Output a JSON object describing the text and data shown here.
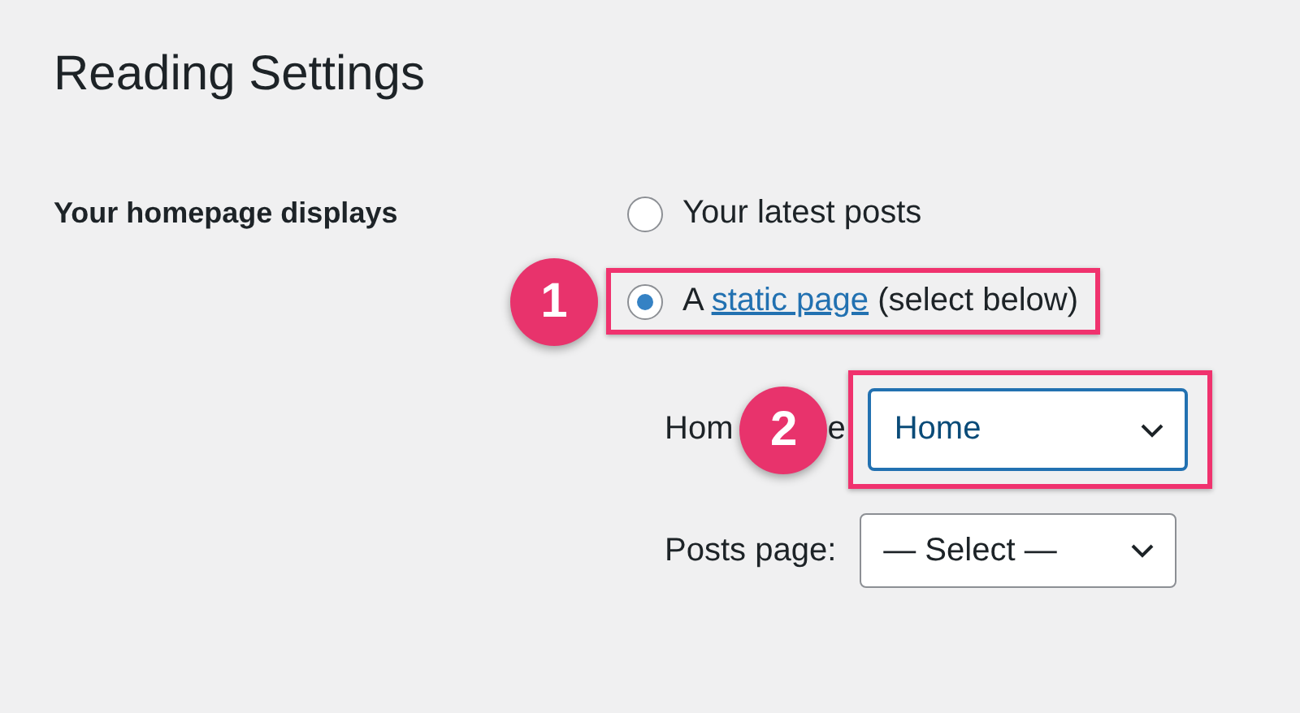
{
  "page": {
    "title": "Reading Settings"
  },
  "homepage_displays": {
    "label": "Your homepage displays",
    "options": [
      {
        "kind": "plain",
        "label": "Your latest posts",
        "selected": false
      },
      {
        "kind": "link",
        "prefix": "A",
        "link": "static page",
        "suffix": "(select below)",
        "selected": true,
        "badge": "1"
      }
    ]
  },
  "homepage_select": {
    "label_parts": [
      "Hom",
      "e"
    ],
    "value": "Home",
    "focused": true,
    "badge": "2"
  },
  "posts_select": {
    "label": "Posts page:",
    "value": "— Select —",
    "focused": false
  }
}
